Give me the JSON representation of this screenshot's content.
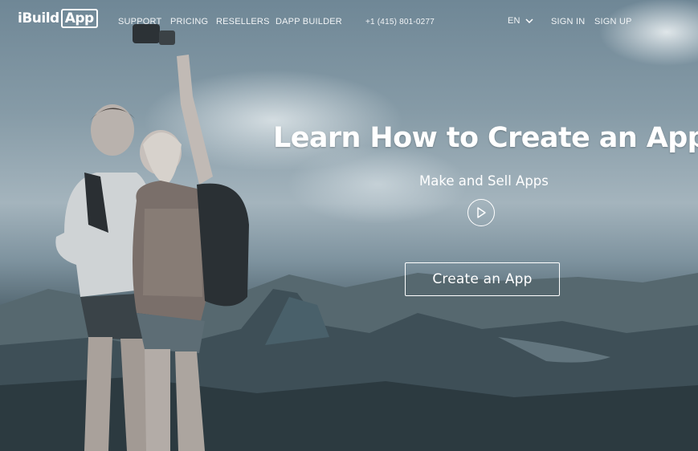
{
  "brand": {
    "logo_left": "iBuild",
    "logo_right": "App"
  },
  "nav": {
    "items": [
      "SUPPORT",
      "PRICING",
      "RESELLERS",
      "DAPP BUILDER"
    ],
    "phone": "+1 (415) 801-0277",
    "language": "EN",
    "sign_in": "SIGN IN",
    "sign_up": "SIGN UP"
  },
  "hero": {
    "headline": "Learn How to Create an App",
    "subheadline": "Make and Sell Apps",
    "cta": "Create an App",
    "play_icon": "play-circle-icon"
  },
  "colors": {
    "text": "#ffffff",
    "overlay": "#3f535e"
  }
}
